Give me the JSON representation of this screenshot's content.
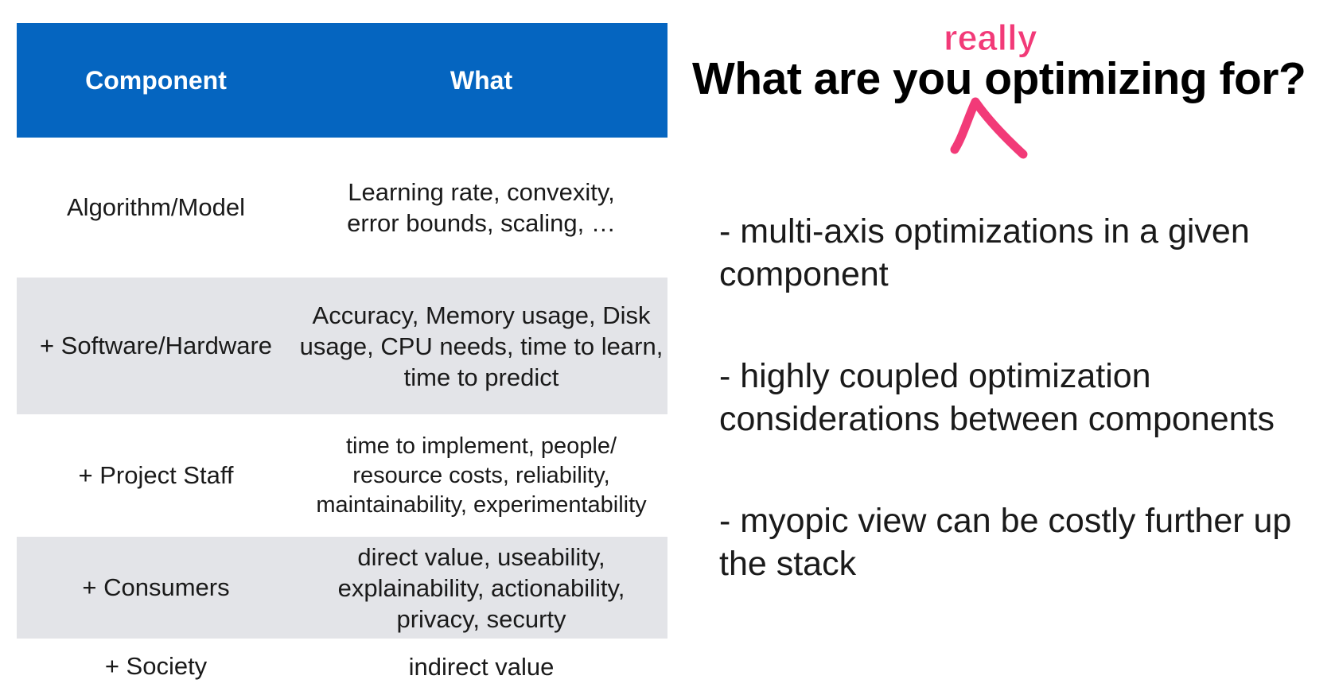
{
  "table": {
    "headers": {
      "component": "Component",
      "what": "What"
    },
    "rows": [
      {
        "component": "Algorithm/Model",
        "what": "Learning rate, convexity, error bounds, scaling, …"
      },
      {
        "component": "+ Software/Hardware",
        "what": "Accuracy, Memory usage, Disk usage, CPU needs, time to learn, time to predict"
      },
      {
        "component": "+ Project Staff",
        "what": "time to implement, people/ resource costs, reliability, maintainability, experimentability"
      },
      {
        "component": "+ Consumers",
        "what": "direct value, useability, explainability, actionability, privacy, securty"
      },
      {
        "component": "+ Society",
        "what": "indirect value"
      }
    ]
  },
  "heading": {
    "title": "What are you optimizing for?",
    "annotation": "really"
  },
  "bullets": [
    "- multi-axis optimizations in a given component",
    "- highly coupled optimization considerations between components",
    "- myopic view can be costly further up the stack"
  ],
  "colors": {
    "header_bg": "#0565c0",
    "shaded_row": "#e3e4e8",
    "annotation": "#f23a78"
  },
  "icons": {
    "insertion_mark": "caret-insert-icon"
  }
}
